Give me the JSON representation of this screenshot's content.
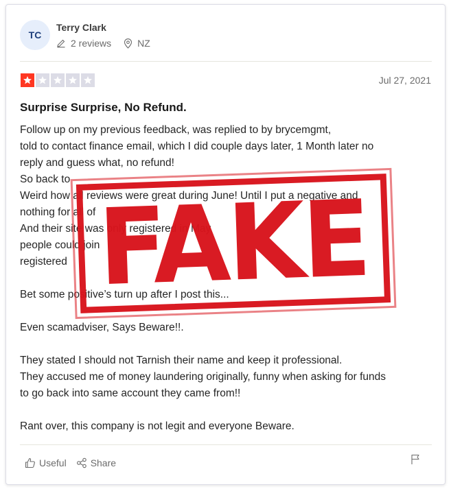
{
  "reviewer": {
    "initials": "TC",
    "name": "Terry Clark",
    "reviews_count": "2 reviews",
    "country": "NZ"
  },
  "review": {
    "rating": 1,
    "max_rating": 5,
    "date": "Jul 27, 2021",
    "title": "Surprise Surprise, No Refund.",
    "body_lines": [
      "Follow up on my previous feedback, was replied to by brycemgmt,",
      "told to contact finance email, which I did couple days later, 1 Month later no",
      "reply and guess what, no refund!",
      "So back to",
      "Weird how all reviews were great during June! Until I put a negative and",
      "nothing for all of",
      "And their site was only registered in May",
      "people could join",
      "registered",
      "",
      "Bet some positive’s turn up after I post this...",
      "",
      "Even scamadviser, Says Beware!!.",
      "",
      "They stated I should not Tarnish their name and keep it professional.",
      "They accused me of money laundering originally, funny when asking for funds",
      "to go back into same account they came from!!",
      "",
      "Rant over, this company is not legit and everyone Beware."
    ]
  },
  "actions": {
    "useful_label": "Useful",
    "share_label": "Share"
  },
  "stamp": {
    "text": "FAKE",
    "color": "#d8141c"
  },
  "colors": {
    "star_filled": "#ff3722",
    "star_empty": "#dcdce6",
    "avatar_bg": "#e6eefb"
  },
  "icons": {
    "reviews": "pencil-icon",
    "location": "location-pin-icon",
    "useful": "thumbs-up-icon",
    "share": "share-icon",
    "report": "flag-icon"
  }
}
